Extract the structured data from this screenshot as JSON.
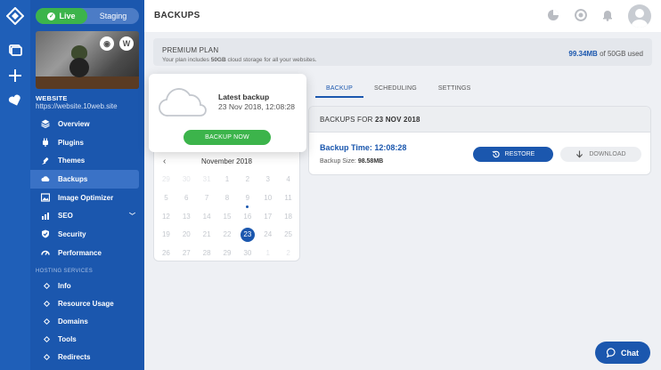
{
  "rail": {
    "icons": [
      "logo-icon",
      "sites-icon",
      "add-icon",
      "heart-icon"
    ]
  },
  "sidebar": {
    "toggle": {
      "live": "Live",
      "staging": "Staging"
    },
    "site_name": "WEBSITE",
    "site_url": "https://website.10web.site",
    "items": [
      {
        "label": "Overview",
        "icon": "overview-icon"
      },
      {
        "label": "Plugins",
        "icon": "plugins-icon"
      },
      {
        "label": "Themes",
        "icon": "themes-icon"
      },
      {
        "label": "Backups",
        "icon": "cloud-icon",
        "active": true
      },
      {
        "label": "Image Optimizer",
        "icon": "image-icon"
      },
      {
        "label": "SEO",
        "icon": "seo-icon"
      },
      {
        "label": "Security",
        "icon": "shield-icon"
      },
      {
        "label": "Performance",
        "icon": "gauge-icon"
      }
    ],
    "hosting_label": "HOSTING SERVICES",
    "hosting_items": [
      {
        "label": "Info"
      },
      {
        "label": "Resource Usage"
      },
      {
        "label": "Domains"
      },
      {
        "label": "Tools"
      },
      {
        "label": "Redirects"
      }
    ]
  },
  "header": {
    "title": "BACKUPS"
  },
  "plan": {
    "name": "PREMIUM PLAN",
    "desc_prefix": "Your plan includes ",
    "desc_bold": "50GB",
    "desc_suffix": " cloud storage for all your websites.",
    "used": "99.34MB",
    "total": " of 50GB used"
  },
  "tabs": [
    {
      "label": "BACKUP",
      "active": true
    },
    {
      "label": "SCHEDULING"
    },
    {
      "label": "SETTINGS"
    }
  ],
  "backup_panel": {
    "head_prefix": "BACKUPS FOR ",
    "head_date": "23 NOV 2018",
    "time": "Backup Time: 12:08:28",
    "size_label": "Backup Size: ",
    "size_value": "98.58MB",
    "restore": "RESTORE",
    "download": "DOWNLOAD"
  },
  "popup": {
    "title": "Latest backup",
    "date": "23 Nov 2018, 12:08:28",
    "button": "BACKUP NOW"
  },
  "calendar": {
    "month": "November 2018",
    "selected": "23",
    "marked": "9",
    "days": [
      {
        "d": "29",
        "o": true
      },
      {
        "d": "30",
        "o": true
      },
      {
        "d": "31",
        "o": true
      },
      {
        "d": "1"
      },
      {
        "d": "2"
      },
      {
        "d": "3"
      },
      {
        "d": "4"
      },
      {
        "d": "5"
      },
      {
        "d": "6"
      },
      {
        "d": "7"
      },
      {
        "d": "8"
      },
      {
        "d": "9"
      },
      {
        "d": "10"
      },
      {
        "d": "11"
      },
      {
        "d": "12"
      },
      {
        "d": "13"
      },
      {
        "d": "14"
      },
      {
        "d": "15"
      },
      {
        "d": "16"
      },
      {
        "d": "17"
      },
      {
        "d": "18"
      },
      {
        "d": "19"
      },
      {
        "d": "20"
      },
      {
        "d": "21"
      },
      {
        "d": "22"
      },
      {
        "d": "23"
      },
      {
        "d": "24"
      },
      {
        "d": "25"
      },
      {
        "d": "26"
      },
      {
        "d": "27"
      },
      {
        "d": "28"
      },
      {
        "d": "29"
      },
      {
        "d": "30"
      },
      {
        "d": "1",
        "o": true
      },
      {
        "d": "2",
        "o": true
      }
    ]
  },
  "chat": {
    "label": "Chat"
  },
  "colors": {
    "primary": "#1b57ae",
    "live": "#3cb44b",
    "background": "#eef0f4"
  }
}
